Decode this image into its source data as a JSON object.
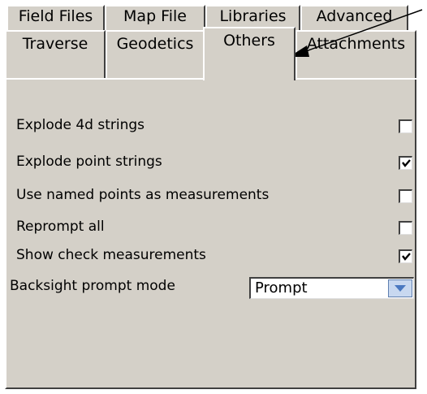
{
  "tabs_row1": [
    "Field Files",
    "Map File",
    "Libraries",
    "Advanced"
  ],
  "tabs_row2": [
    "Traverse",
    "Geodetics",
    "Others",
    "Attachments"
  ],
  "active_tab": "Others",
  "options": [
    {
      "label": "Explode 4d strings",
      "checked": false
    },
    {
      "label": "Explode point strings",
      "checked": true
    },
    {
      "label": "Use named points as measurements",
      "checked": false
    },
    {
      "label": "Reprompt all",
      "checked": false
    },
    {
      "label": "Show check measurements",
      "checked": true
    }
  ],
  "backsight": {
    "label": "Backsight prompt mode",
    "value": "Prompt"
  },
  "icons": {
    "dropdown": "chevron-down-icon",
    "annotation": "arrow-pointer"
  }
}
